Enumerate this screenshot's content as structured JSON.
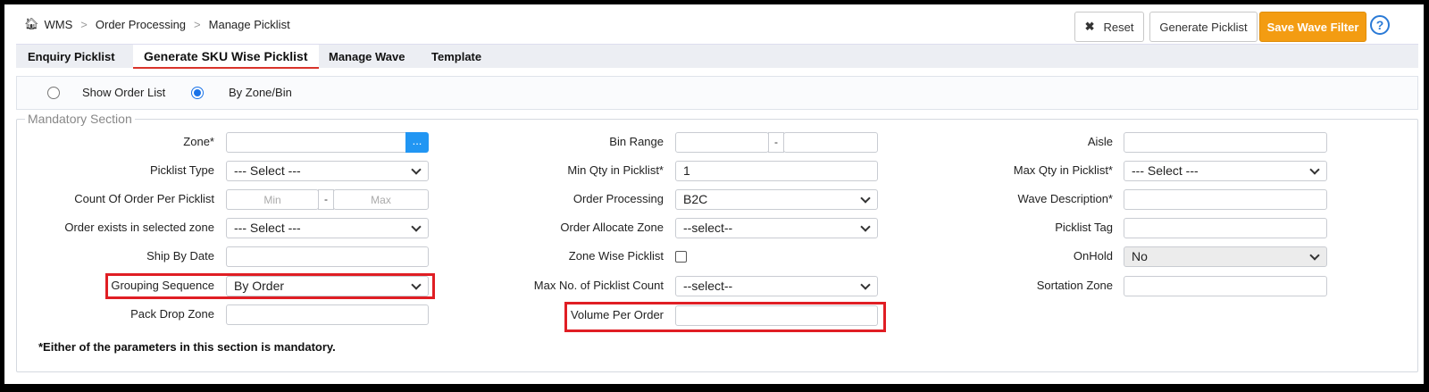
{
  "breadcrumb": {
    "home_icon": "home-icon",
    "items": [
      "WMS",
      "Order Processing",
      "Manage Picklist"
    ]
  },
  "toolbar": {
    "reset": "Reset",
    "generate": "Generate Picklist",
    "save": "Save Wave Filter",
    "help": "?"
  },
  "tabs": [
    "Enquiry Picklist",
    "Generate SKU Wise Picklist",
    "Manage Wave",
    "Template"
  ],
  "radios": {
    "show_order_list": "Show Order List",
    "by_zone_bin": "By Zone/Bin"
  },
  "section": {
    "legend": "Mandatory Section",
    "note": "*Either of the parameters in this section is mandatory."
  },
  "col1": {
    "zone": {
      "label": "Zone*",
      "value": "",
      "btn": "..."
    },
    "picklist_type": {
      "label": "Picklist Type",
      "value": "--- Select ---"
    },
    "count_order": {
      "label": "Count Of Order Per Picklist",
      "min": "Min",
      "max": "Max",
      "sep": "-"
    },
    "order_exists": {
      "label": "Order exists in selected zone",
      "value": "--- Select ---"
    },
    "ship_by": {
      "label": "Ship By Date",
      "value": ""
    },
    "grouping": {
      "label": "Grouping Sequence",
      "value": "By Order"
    },
    "pack_drop": {
      "label": "Pack Drop Zone",
      "value": ""
    }
  },
  "col2": {
    "bin_range": {
      "label": "Bin Range",
      "sep": "-"
    },
    "min_qty": {
      "label": "Min Qty in Picklist*",
      "value": "1"
    },
    "order_processing": {
      "label": "Order Processing",
      "value": "B2C"
    },
    "order_alloc": {
      "label": "Order Allocate Zone",
      "value": "--select--"
    },
    "zone_wise": {
      "label": "Zone Wise Picklist"
    },
    "max_picklist": {
      "label": "Max No. of Picklist Count",
      "value": "--select--"
    },
    "volume": {
      "label": "Volume Per Order",
      "value": ""
    }
  },
  "col3": {
    "aisle": {
      "label": "Aisle",
      "value": ""
    },
    "max_qty": {
      "label": "Max Qty in Picklist*",
      "value": "--- Select ---"
    },
    "wave_desc": {
      "label": "Wave Description*",
      "value": ""
    },
    "picklist_tag": {
      "label": "Picklist Tag",
      "value": ""
    },
    "onhold": {
      "label": "OnHold",
      "value": "No"
    },
    "sortation": {
      "label": "Sortation Zone",
      "value": ""
    }
  },
  "colors": {
    "accent": "#f39c12",
    "primary": "#2196f3",
    "highlight": "#e01e24",
    "active_tab": "#d9342b"
  }
}
